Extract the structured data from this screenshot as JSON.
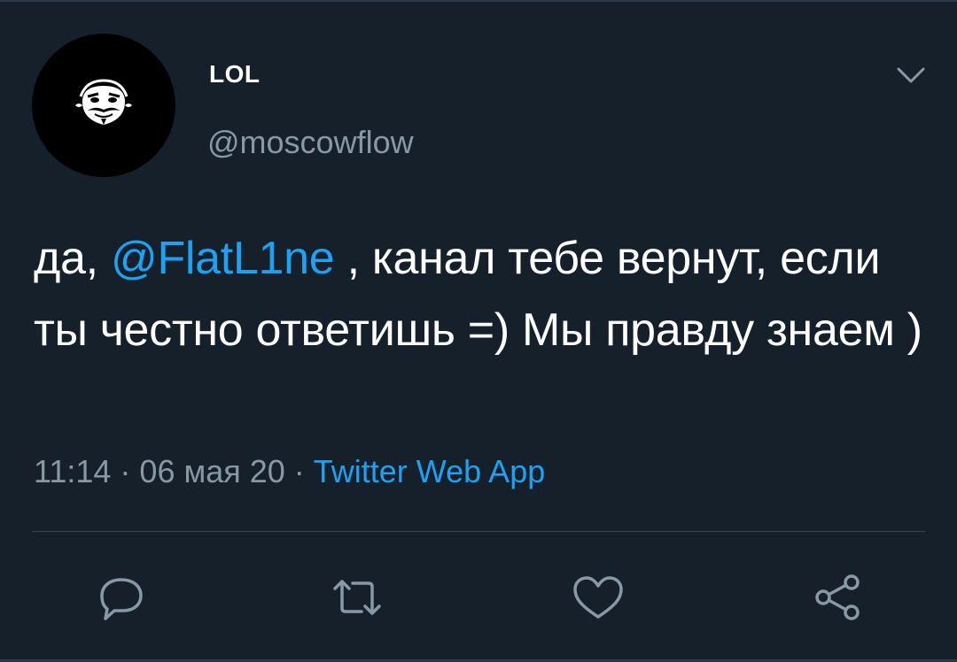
{
  "tweet": {
    "display_name": "LOL",
    "handle": "@moscowflow",
    "text_before_mention": "да, ",
    "mention": "@FlatL1ne",
    "text_after_mention": " , канал тебе вернут, если ты честно ответишь =) Мы правду знаем )",
    "time": "11:14",
    "separator": " · ",
    "date": "06 мая 20",
    "source": "Twitter Web App"
  },
  "icons": {
    "avatar": "guy-fawkes-mask-icon",
    "menu": "chevron-down-icon",
    "reply": "reply-icon",
    "retweet": "retweet-icon",
    "like": "heart-icon",
    "share": "share-icon"
  },
  "colors": {
    "background": "#15202b",
    "text": "#ffffff",
    "secondary": "#8899a6",
    "accent": "#1da1f2",
    "divider": "#38444d"
  }
}
